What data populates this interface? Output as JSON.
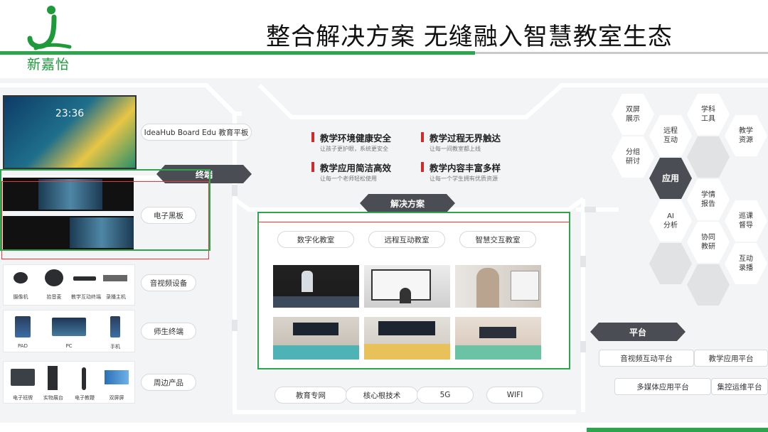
{
  "header": {
    "title": "整合解决方案 无缝融入智慧教室生态",
    "logo_text": "新嘉怡",
    "logo_mark": "logo-icon"
  },
  "left": {
    "product_label": "IdeaHub Board Edu 教育平板",
    "screen_time": "23:36",
    "terminal_tag": "终端",
    "blackboard_label": "电子黑板",
    "av": {
      "label": "音视频设备",
      "devices": [
        "摄像机",
        "拾音麦",
        "教学互动终端",
        "录播主机"
      ]
    },
    "teacher": {
      "label": "师生终端",
      "devices": [
        "PAD",
        "PC",
        "手机"
      ]
    },
    "periph": {
      "label": "周边产品",
      "devices": [
        "电子班牌",
        "实物展台",
        "电子教鞭",
        "双屏屏"
      ]
    }
  },
  "center": {
    "bullets": [
      {
        "title": "教学环境健康安全",
        "sub": "让孩子更护眼，系统更安全"
      },
      {
        "title": "教学过程无界触达",
        "sub": "让每一间教室都上线"
      },
      {
        "title": "教学应用简洁高效",
        "sub": "让每一个老师轻松使用"
      },
      {
        "title": "教学内容丰富多样",
        "sub": "让每一个学生拥有优质资源"
      }
    ],
    "solution_tag": "解决方案",
    "classrooms": [
      "数字化教室",
      "远程互动教室",
      "智慧交互教室"
    ],
    "base": [
      "教育专网",
      "核心根技术",
      "5G",
      "WIFI"
    ]
  },
  "right": {
    "center_hex": "应用",
    "hexes": [
      "双屏\n展示",
      "学科\n工具",
      "远程\n互动",
      "教学\n资源",
      "分组\n研讨",
      "学情\n报告",
      "AI\n分析",
      "巡课\n督导",
      "协同\n教研",
      "互动\n录播"
    ],
    "platform_tag": "平台",
    "platforms": [
      "音视频互动平台",
      "教学应用平台",
      "多媒体应用平台",
      "集控运维平台"
    ]
  },
  "colors": {
    "accent_green": "#2ea44f",
    "accent_red": "#d12a2a",
    "dark_tag": "#4a4d53"
  }
}
